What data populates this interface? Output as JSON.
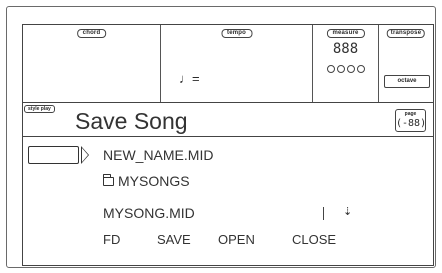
{
  "header": {
    "chord_label": "chord",
    "tempo_label": "tempo",
    "tempo_note_icon": "quarter-note-icon",
    "tempo_note_symbol": "♩=",
    "measure_label": "measure",
    "measure_display": "888",
    "transpose_label": "transpose",
    "octave_label": "octave"
  },
  "mode": {
    "tag": "style play",
    "title": "Save Song",
    "page_label": "page",
    "page_number": "(-88)"
  },
  "file_list": {
    "target_name": "NEW_NAME.MID",
    "folder_icon": "folder-icon",
    "folder_name": "MYSONGS",
    "file_name": "MYSONG.MID",
    "scroll_icon": "down-arrow-icon",
    "scroll_symbol": "⇣"
  },
  "buttons": {
    "fd": "FD",
    "save": "SAVE",
    "open": "OPEN",
    "close": "CLOSE"
  }
}
